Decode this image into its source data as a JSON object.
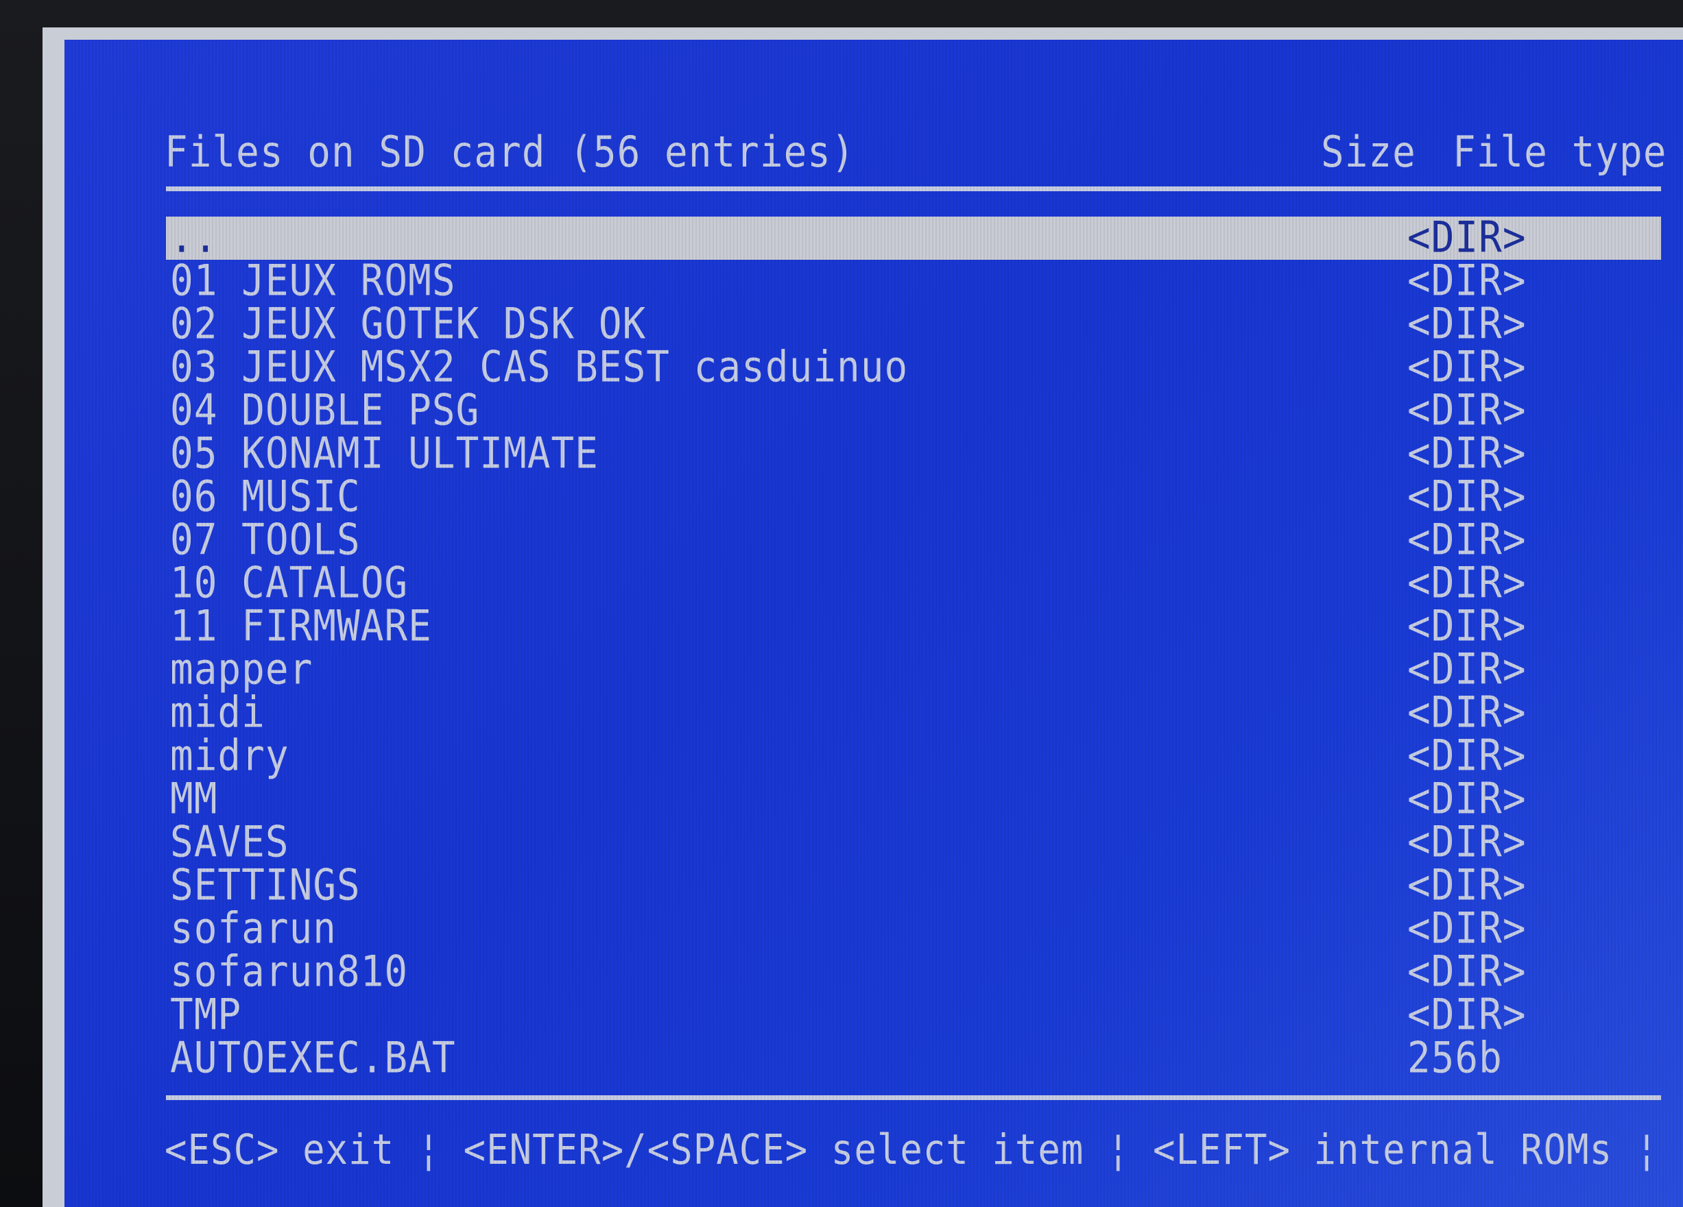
{
  "header": {
    "title": "Files on SD card (56 entries)",
    "size_label": "Size",
    "type_label": "File type"
  },
  "files": [
    {
      "name": "..",
      "size": "<DIR>",
      "selected": true
    },
    {
      "name": "01 JEUX ROMS",
      "size": "<DIR>"
    },
    {
      "name": "02 JEUX GOTEK DSK OK",
      "size": "<DIR>"
    },
    {
      "name": "03 JEUX MSX2 CAS BEST casduinuo",
      "size": "<DIR>"
    },
    {
      "name": "04 DOUBLE PSG",
      "size": "<DIR>"
    },
    {
      "name": "05 KONAMI ULTIMATE",
      "size": "<DIR>"
    },
    {
      "name": "06 MUSIC",
      "size": "<DIR>"
    },
    {
      "name": "07 TOOLS",
      "size": "<DIR>"
    },
    {
      "name": "10 CATALOG",
      "size": "<DIR>"
    },
    {
      "name": "11 FIRMWARE",
      "size": "<DIR>"
    },
    {
      "name": "mapper",
      "size": "<DIR>"
    },
    {
      "name": "midi",
      "size": "<DIR>"
    },
    {
      "name": "midry",
      "size": "<DIR>"
    },
    {
      "name": "MM",
      "size": "<DIR>"
    },
    {
      "name": "SAVES",
      "size": "<DIR>"
    },
    {
      "name": "SETTINGS",
      "size": "<DIR>"
    },
    {
      "name": "sofarun",
      "size": "<DIR>"
    },
    {
      "name": "sofarun810",
      "size": "<DIR>"
    },
    {
      "name": "TMP",
      "size": "<DIR>"
    },
    {
      "name": "AUTOEXEC.BAT",
      "size": "256b"
    }
  ],
  "footer": {
    "help_text": "<ESC> exit ¦ <ENTER>/<SPACE> select item ¦ <LEFT> internal ROMs ¦ <HOME> help"
  },
  "colors": {
    "screen_bg": "#1f3bd8",
    "text": "#c6cde3",
    "selection_bg": "#c9ccd4",
    "selection_text": "#1c2f9c"
  }
}
